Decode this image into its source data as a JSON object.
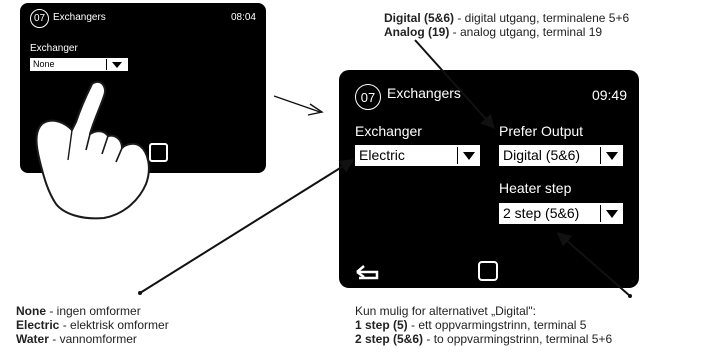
{
  "small_screen": {
    "badge": "07",
    "title": "Exchangers",
    "time": "08:04",
    "exchanger_label": "Exchanger",
    "exchanger_value": "None"
  },
  "large_screen": {
    "badge": "07",
    "title": "Exchangers",
    "time": "09:49",
    "exchanger_label": "Exchanger",
    "exchanger_value": "Electric",
    "prefer_output_label": "Prefer Output",
    "prefer_output_value": "Digital (5&6)",
    "heater_step_label": "Heater step",
    "heater_step_value": "2 step (5&6)"
  },
  "annotations": {
    "output": [
      {
        "term": "Digital (5&6)",
        "desc": " - digital utgang, terminalene 5+6"
      },
      {
        "term": "Analog (19)",
        "desc": " - analog utgang, terminal 19"
      }
    ],
    "exchanger": [
      {
        "term": "None",
        "desc": " - ingen omformer"
      },
      {
        "term": "Electric",
        "desc": " - elektrisk omformer"
      },
      {
        "term": "Water",
        "desc": " - vannomformer"
      }
    ],
    "heater_intro": "Kun mulig for alternativet „Digital\":",
    "heater": [
      {
        "term": "1 step (5)",
        "desc": " - ett oppvarmingstrinn, terminal 5"
      },
      {
        "term": "2 step (5&6)",
        "desc": " - to oppvarmingstrinn, terminal 5+6"
      }
    ]
  },
  "colors": {
    "screen": "#000000",
    "text_on_screen": "#ffffff",
    "select_bg": "#ffffff"
  },
  "icons": [
    "hand-pointer-icon",
    "home-button-icon",
    "back-icon",
    "dropdown-arrow-icon",
    "arrow-pointer-icon"
  ]
}
